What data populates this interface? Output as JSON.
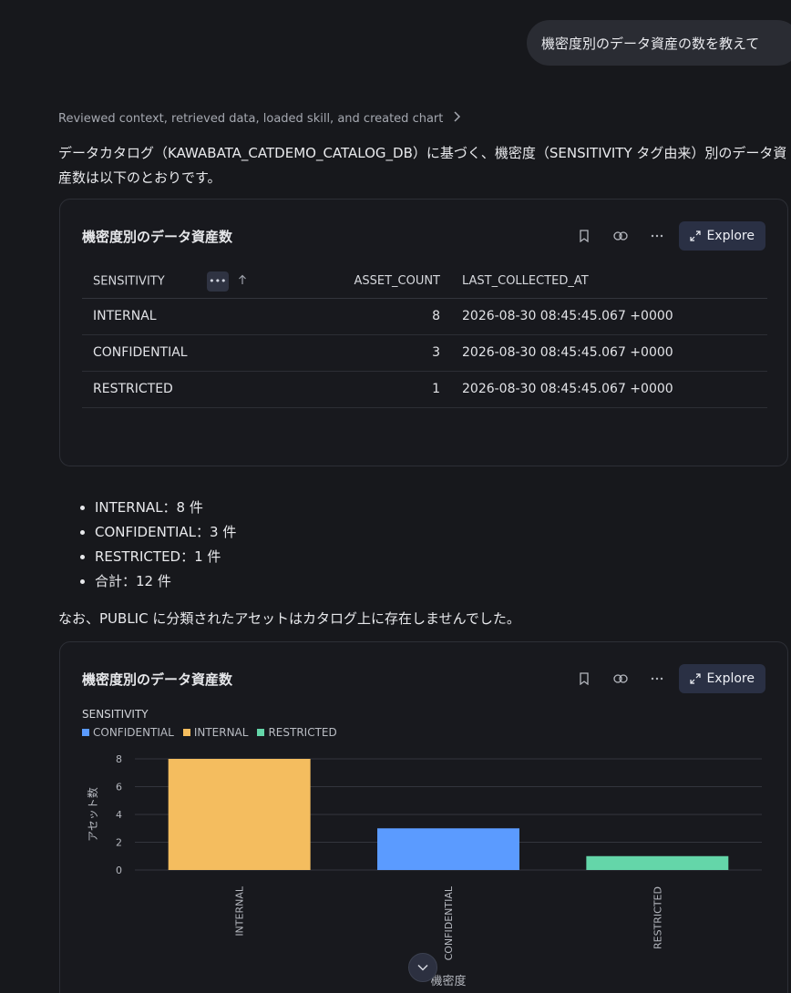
{
  "user_message": "機密度別のデータ資産の数を教えて",
  "reviewed": {
    "text": "Reviewed context, retrieved data, loaded skill, and created chart"
  },
  "intro_text": "データカタログ（KAWABATA_CATDEMO_CATALOG_DB）に基づく、機密度（SENSITIVITY タグ由来）別のデータ資産数は以下のとおりです。",
  "table_card": {
    "title": "機密度別のデータ資産数",
    "explore_label": "Explore",
    "columns": [
      "SENSITIVITY",
      "ASSET_COUNT",
      "LAST_COLLECTED_AT"
    ],
    "rows": [
      [
        "INTERNAL",
        "8",
        "2026-08-30 08:45:45.067 +0000"
      ],
      [
        "CONFIDENTIAL",
        "3",
        "2026-08-30 08:45:45.067 +0000"
      ],
      [
        "RESTRICTED",
        "1",
        "2026-08-30 08:45:45.067 +0000"
      ]
    ]
  },
  "bullets": [
    "INTERNAL：8 件",
    "CONFIDENTIAL：3 件",
    "RESTRICTED：1 件",
    "合計：12 件"
  ],
  "note_text": "なお、PUBLIC に分類されたアセットはカタログ上に存在しませんでした。",
  "chart_card": {
    "title": "機密度別のデータ資産数",
    "explore_label": "Explore",
    "legend_title": "SENSITIVITY"
  },
  "chart_data": {
    "type": "bar",
    "categories": [
      "INTERNAL",
      "CONFIDENTIAL",
      "RESTRICTED"
    ],
    "values": [
      8,
      3,
      1
    ],
    "colors": [
      "#f4bd5f",
      "#5b9bff",
      "#64d6a9"
    ],
    "legend": [
      {
        "name": "CONFIDENTIAL",
        "color": "#5b9bff"
      },
      {
        "name": "INTERNAL",
        "color": "#f4bd5f"
      },
      {
        "name": "RESTRICTED",
        "color": "#64d6a9"
      }
    ],
    "xlabel": "機密度",
    "ylabel": "アセット数",
    "yticks": [
      0,
      2,
      4,
      6,
      8
    ],
    "ylim": [
      0,
      8
    ],
    "grid": true,
    "legend_placement": "top-left"
  }
}
